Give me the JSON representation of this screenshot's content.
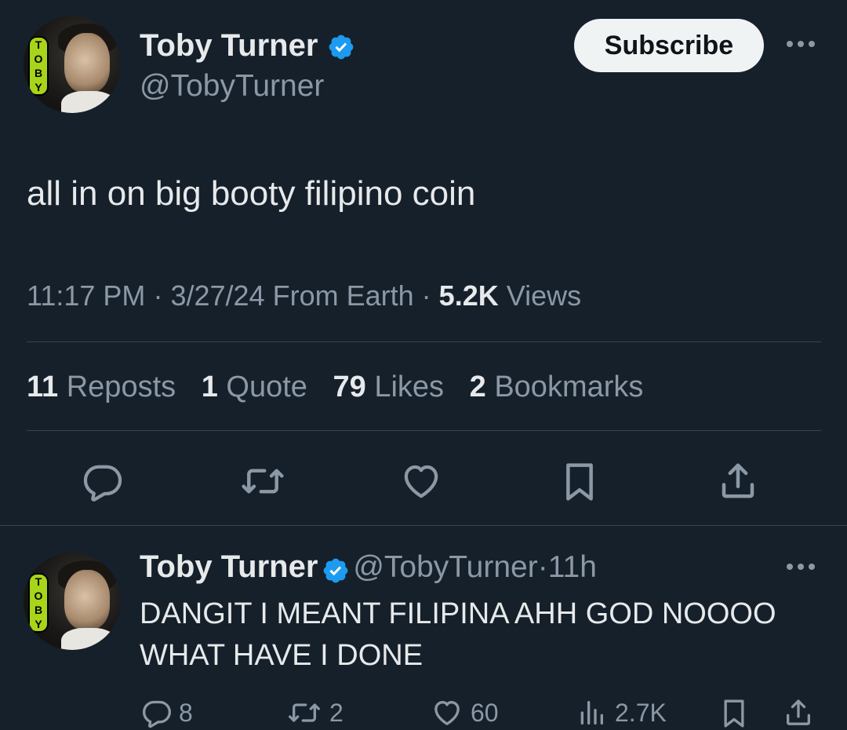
{
  "tweet": {
    "author": {
      "name": "Toby Turner",
      "handle": "@TobyTurner",
      "avatar_badge": [
        "T",
        "O",
        "B",
        "Y"
      ]
    },
    "subscribe_label": "Subscribe",
    "text": "all in on big booty filipino coin",
    "time": "11:17 PM",
    "date": "3/27/24",
    "location": "From Earth",
    "views_count": "5.2K",
    "views_label": "Views",
    "sep": "·",
    "stats": {
      "reposts_count": "11",
      "reposts_label": "Reposts",
      "quotes_count": "1",
      "quotes_label": "Quote",
      "likes_count": "79",
      "likes_label": "Likes",
      "bookmarks_count": "2",
      "bookmarks_label": "Bookmarks"
    }
  },
  "reply": {
    "name": "Toby Turner",
    "handle": "@TobyTurner",
    "sep": "·",
    "age": "11h",
    "text": "DANGIT I MEANT FILIPINA AHH GOD NOOOO WHAT HAVE I DONE",
    "counts": {
      "replies": "8",
      "reposts": "2",
      "likes": "60",
      "views": "2.7K"
    }
  },
  "icons": {
    "verified": "verified-badge-icon",
    "more": "more-icon",
    "reply": "reply-icon",
    "repost": "repost-icon",
    "like": "heart-icon",
    "bookmark": "bookmark-icon",
    "share": "share-icon",
    "views": "views-icon"
  },
  "colors": {
    "background": "#15202b",
    "verified": "#1d9bf0",
    "muted": "#8b98a5",
    "text": "#e7e9ea",
    "subscribe_bg": "#eff3f4"
  }
}
